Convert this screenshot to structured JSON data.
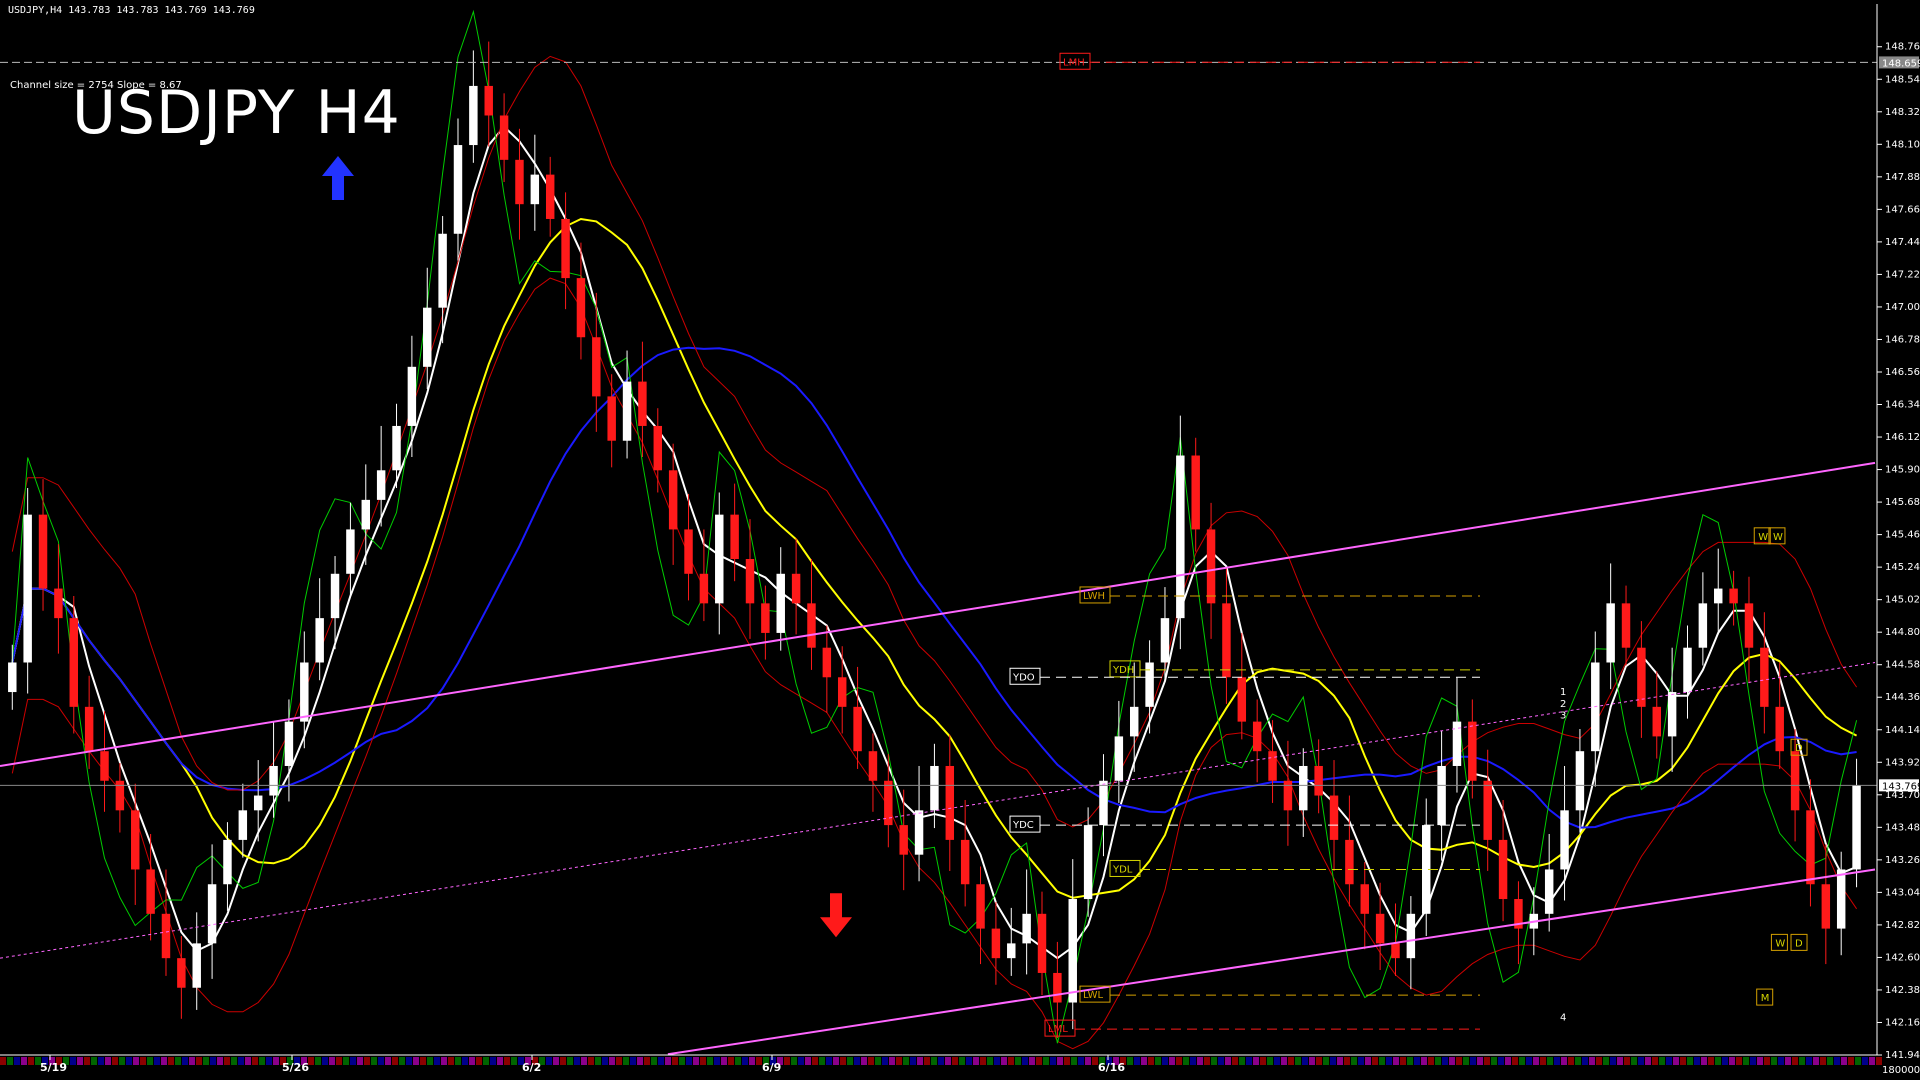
{
  "header": {
    "symbol_info": "USDJPY,H4  143.783 143.783 143.769 143.769",
    "channel_info": "Channel size = 2754 Slope = 8.67",
    "title": "USDJPY H4"
  },
  "colors": {
    "background": "#000000",
    "bull_candle": "#ffffff",
    "bear_candle": "#ff1a1a",
    "channel": "#ff66ff",
    "ma_white": "#ffffff",
    "ma_yellow": "#ffff00",
    "ma_blue": "#1a1aff",
    "ichimoku_green": "#00cc00",
    "bollinger_red": "#cc0000"
  },
  "chart_data": {
    "type": "candlestick",
    "title": "USDJPY H4",
    "ylim": [
      141.945,
      149.0
    ],
    "price_ticks": [
      "148.765",
      "148.545",
      "148.325",
      "148.105",
      "147.885",
      "147.665",
      "147.445",
      "147.225",
      "147.005",
      "146.785",
      "146.565",
      "146.345",
      "146.125",
      "145.905",
      "145.685",
      "145.465",
      "145.245",
      "145.025",
      "144.805",
      "144.585",
      "144.365",
      "144.145",
      "143.925",
      "143.705",
      "143.485",
      "143.265",
      "143.045",
      "142.825",
      "142.605",
      "142.385",
      "142.165",
      "141.945"
    ],
    "current_price": "143.769",
    "top_price_label": "148.659",
    "date_ticks": [
      "5/19",
      "5/26",
      "6/2",
      "6/9",
      "6/16"
    ],
    "bottom_scale": "180000",
    "close_series": [
      144.6,
      145.6,
      145.1,
      144.9,
      144.3,
      144.0,
      143.8,
      143.6,
      143.2,
      142.9,
      142.6,
      142.4,
      142.7,
      143.1,
      143.4,
      143.6,
      143.7,
      143.9,
      144.2,
      144.6,
      144.9,
      145.2,
      145.5,
      145.7,
      145.9,
      146.2,
      146.6,
      147.0,
      147.5,
      148.1,
      148.5,
      148.3,
      148.0,
      147.7,
      147.9,
      147.6,
      147.2,
      146.8,
      146.4,
      146.1,
      146.5,
      146.2,
      145.9,
      145.5,
      145.2,
      145.0,
      145.6,
      145.3,
      145.0,
      144.8,
      145.2,
      145.0,
      144.7,
      144.5,
      144.3,
      144.0,
      143.8,
      143.5,
      143.3,
      143.6,
      143.9,
      143.4,
      143.1,
      142.8,
      142.6,
      142.7,
      142.9,
      142.5,
      142.3,
      143.0,
      143.5,
      143.8,
      144.1,
      144.3,
      144.6,
      144.9,
      146.0,
      145.5,
      145.0,
      144.5,
      144.2,
      144.0,
      143.8,
      143.6,
      143.9,
      143.7,
      143.4,
      143.1,
      142.9,
      142.7,
      142.6,
      142.9,
      143.5,
      143.9,
      144.2,
      143.8,
      143.4,
      143.0,
      142.8,
      142.9,
      143.2,
      143.6,
      144.0,
      144.6,
      145.0,
      144.7,
      144.3,
      144.1,
      144.4,
      144.7,
      145.0,
      145.1,
      145.0,
      144.7,
      144.3,
      144.0,
      143.6,
      143.1,
      142.8,
      143.2,
      143.769
    ],
    "channel_upper": [
      [
        0,
        143.9
      ],
      [
        1530,
        145.95
      ]
    ],
    "channel_lower": [
      [
        545,
        141.95
      ],
      [
        1530,
        143.2
      ]
    ],
    "channel_mid": [
      [
        0,
        142.6
      ],
      [
        1530,
        144.6
      ]
    ],
    "levels": [
      {
        "label": "LMH",
        "price": 148.66,
        "color": "#ff1a1a"
      },
      {
        "label": "LWH",
        "price": 145.05,
        "color": "#d4a000"
      },
      {
        "label": "YDH",
        "price": 144.55,
        "color": "#d4d400"
      },
      {
        "label": "YDO",
        "price": 144.5,
        "color": "#ffffff"
      },
      {
        "label": "YDC",
        "price": 143.5,
        "color": "#ffffff"
      },
      {
        "label": "YDL",
        "price": 143.2,
        "color": "#d4d400"
      },
      {
        "label": "LWL",
        "price": 142.35,
        "color": "#d4a000"
      },
      {
        "label": "LML",
        "price": 142.12,
        "color": "#ff1a1a"
      }
    ],
    "markers": [
      {
        "label": "W",
        "kind": "box"
      },
      {
        "label": "D",
        "kind": "box"
      },
      {
        "label": "W",
        "kind": "box"
      },
      {
        "label": "D",
        "kind": "box"
      },
      {
        "label": "M",
        "kind": "box"
      },
      {
        "label": "W",
        "kind": "box"
      }
    ],
    "projection_labels": [
      "1",
      "2",
      "3",
      "4"
    ]
  }
}
